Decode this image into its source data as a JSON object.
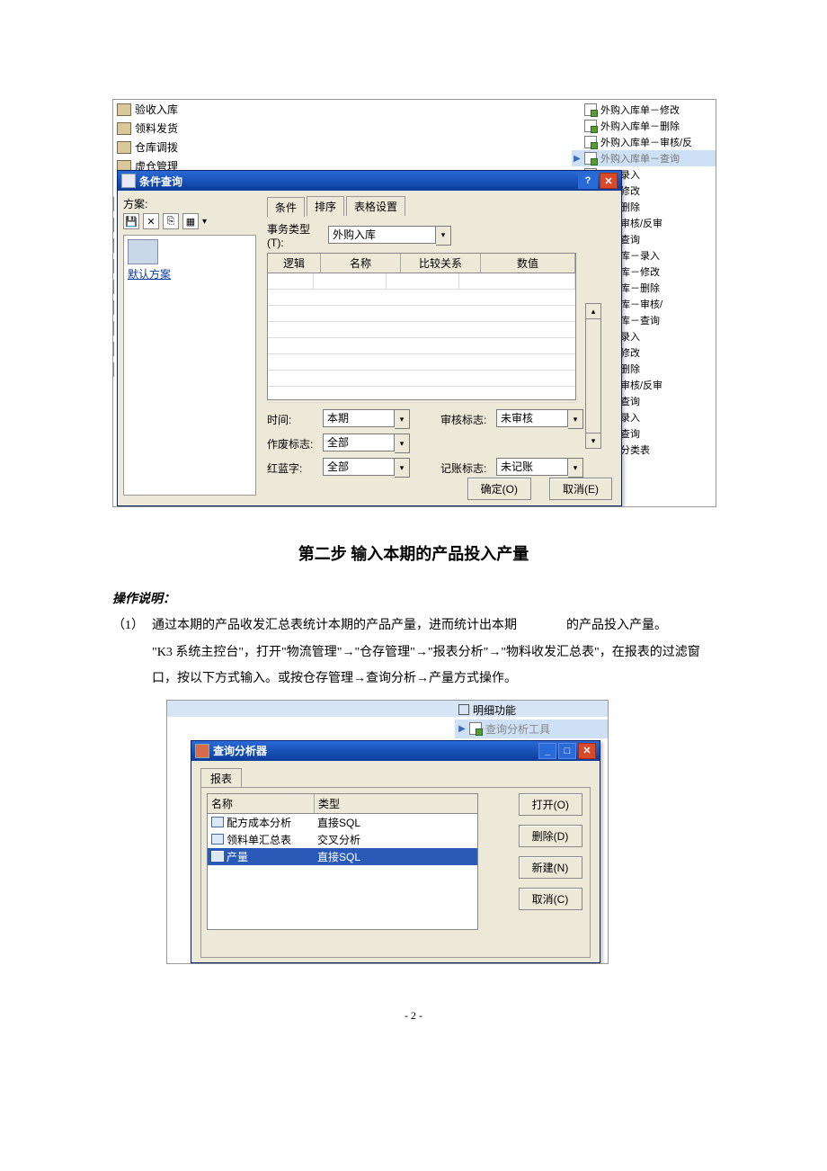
{
  "shot1": {
    "leftSidebar": [
      "验收入库",
      "领料发货",
      "仓库调拨",
      "虚仓管理"
    ],
    "rightSidebar": [
      {
        "t": "外购入库单－修改",
        "arrow": false
      },
      {
        "t": "外购入库单－删除",
        "arrow": false
      },
      {
        "t": "外购入库单－审核/反",
        "arrow": false
      },
      {
        "t": "外购入库单－查询",
        "arrow": true,
        "active": true
      },
      {
        "t": "库－录入"
      },
      {
        "t": "库－修改"
      },
      {
        "t": "库－删除"
      },
      {
        "t": "库－审核/反审"
      },
      {
        "t": "库－查询"
      },
      {
        "t": "工入库－录入"
      },
      {
        "t": "工入库－修改"
      },
      {
        "t": "工入库－删除"
      },
      {
        "t": "工入库－审核/"
      },
      {
        "t": "工入库－查询"
      },
      {
        "t": "库－录入"
      },
      {
        "t": "库－修改"
      },
      {
        "t": "库－删除"
      },
      {
        "t": "库－审核/反审"
      },
      {
        "t": "库－查询"
      },
      {
        "t": "库－录入"
      },
      {
        "t": "库－查询"
      },
      {
        "t": "库单分类表"
      }
    ],
    "dlg": {
      "title": "条件查询",
      "schemeLabel": "方案:",
      "defaultScheme": "默认方案",
      "tabs": [
        "条件",
        "排序",
        "表格设置"
      ],
      "bizTypeLabel": "事务类型(T):",
      "bizType": "外购入库",
      "gridHeaders": [
        "逻辑",
        "名称",
        "比较关系",
        "数值"
      ],
      "timeLabel": "时间:",
      "time": "本期",
      "auditLabel": "审核标志:",
      "audit": "未审核",
      "voidLabel": "作废标志:",
      "void": "全部",
      "colorLabel": "红蓝字:",
      "color": "全部",
      "postLabel": "记账标志:",
      "post": "未记账",
      "ok": "确定(O)",
      "cancel": "取消(E)"
    }
  },
  "doc": {
    "stepTitle": "第二步  输入本期的产品投入产量",
    "opHeading": "操作说明：",
    "num": "（1）",
    "para1a": "通过本期的产品收发汇总表统计本期的产品产量，进而统计出本期",
    "para1b": "的产品投入产量。",
    "para2": "\"K3 系统主控台\"，打开\"物流管理\"→\"仓存管理\"→\"报表分析\"→\"物料收发汇总表\"，在报表的过滤窗口，按以下方式输入。或按仓存管理→查询分析→产量方式操作。"
  },
  "shot2": {
    "topRight": [
      {
        "box": true,
        "t": "明细功能"
      },
      {
        "arrow": true,
        "icon": true,
        "t": "查询分析工具",
        "hl": true
      }
    ],
    "dlg": {
      "title": "查询分析器",
      "tab": "报表",
      "headers": [
        "名称",
        "类型"
      ],
      "rows": [
        {
          "name": "配方成本分析",
          "type": "直接SQL"
        },
        {
          "name": "领料单汇总表",
          "type": "交叉分析"
        },
        {
          "name": "产量",
          "type": "直接SQL",
          "sel": true
        }
      ],
      "btns": [
        "打开(O)",
        "删除(D)",
        "新建(N)",
        "取消(C)"
      ]
    }
  },
  "pageNum": "- 2 -"
}
